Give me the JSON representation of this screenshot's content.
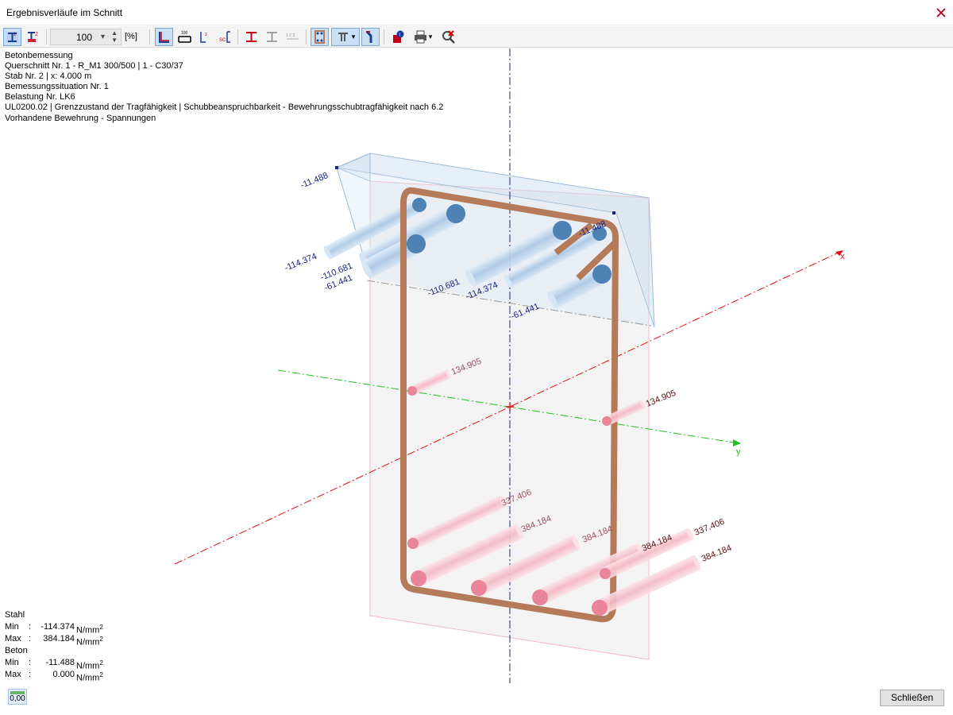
{
  "window": {
    "title": "Ergebnisverläufe im Schnitt"
  },
  "toolbar": {
    "zoom_value": "100",
    "zoom_unit": "[%]",
    "buttons": [
      {
        "icon": "stress-result-icon"
      },
      {
        "icon": "stress-component-icon"
      },
      {
        "icon": "section-outline-icon"
      },
      {
        "icon": "scale-100-icon"
      },
      {
        "icon": "stress-points-icon"
      },
      {
        "icon": "section-parts-icon"
      },
      {
        "icon": "beam-section-icon"
      },
      {
        "icon": "beam-section-alt-icon"
      },
      {
        "icon": "numbering-icon"
      },
      {
        "icon": "reinforcement-view-icon"
      },
      {
        "icon": "t-section-icon"
      },
      {
        "icon": "bent-bar-icon"
      },
      {
        "icon": "info-icon"
      },
      {
        "icon": "print-icon"
      },
      {
        "icon": "reset-view-icon"
      }
    ]
  },
  "info": {
    "line1": "Betonbemessung",
    "line2": "Querschnitt Nr. 1 - R_M1 300/500 | 1 - C30/37",
    "line3": "Stab Nr. 2 | x: 4.000 m",
    "line4": "Bemessungssituation Nr. 1",
    "line5": "Belastung Nr. LK6",
    "line6": "UL0200.02 | Grenzzustand der Tragfähigkeit | Schubbeanspruchbarkeit - Bewehrungsschubtragfähigkeit nach 6.2",
    "line7": "Vorhandene Bewehrung - Spannungen"
  },
  "axes": {
    "x": "x",
    "y": "y"
  },
  "labels3d": {
    "c_top_left": "-11.488",
    "c_top_right": "-11.488",
    "s_114_left": "-114.374",
    "s_110_left": "-110.681",
    "s_61_left": "-61.441",
    "s_110_mid": "-110.681",
    "s_114_mid": "-114.374",
    "s_61_mid": "-61.441",
    "t_134_left": "134.905",
    "t_134_right": "134.905",
    "t_337_left": "337.406",
    "t_384_1": "384.184",
    "t_384_2": "384.184",
    "t_384_3": "384.184",
    "t_337_right": "337.406",
    "t_384_4": "384.184"
  },
  "stats": {
    "steel_heading": "Stahl",
    "steel_min_label": "Min",
    "steel_min_value": "-114.374",
    "steel_max_label": "Max",
    "steel_max_value": "384.184",
    "concrete_heading": "Beton",
    "concrete_min_label": "Min",
    "concrete_min_value": "-11.488",
    "concrete_max_label": "Max",
    "concrete_max_value": "0.000",
    "unit": "N/mm",
    "unit_exp": "2"
  },
  "bottom": {
    "value_icon": "0,00",
    "close_label": "Schließen"
  },
  "colors": {
    "compression": "#4f82b4",
    "tension": "#e9849a",
    "stirrup": "#b47a5a",
    "x_axis": "#e01010",
    "y_axis": "#20c020",
    "z_axis": "#0000aa"
  }
}
